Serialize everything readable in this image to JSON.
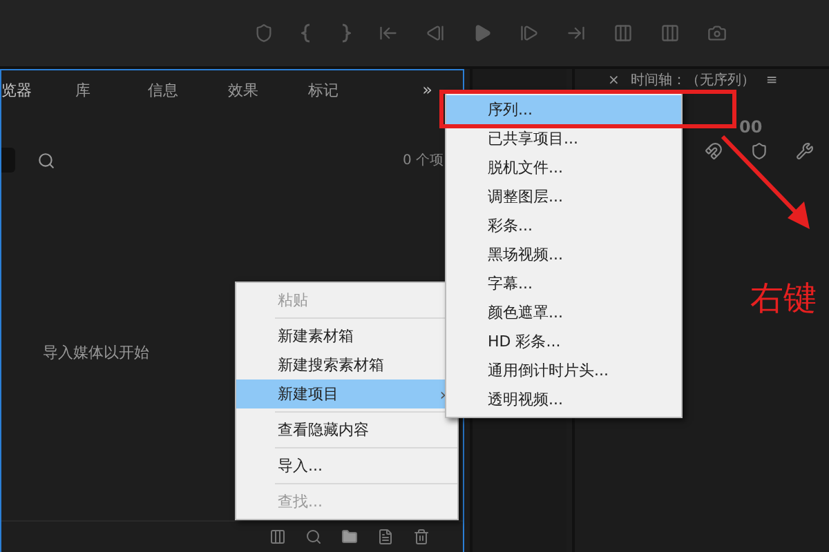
{
  "project_panel": {
    "tabs": [
      {
        "label": "览器",
        "selected": true
      },
      {
        "label": "库",
        "selected": false
      },
      {
        "label": "信息",
        "selected": false
      },
      {
        "label": "效果",
        "selected": false
      },
      {
        "label": "标记",
        "selected": false
      }
    ],
    "overflow": "»",
    "item_count": "0 个项",
    "empty_hint": "导入媒体以开始"
  },
  "timeline_panel": {
    "close": "×",
    "title": "时间轴：（无序列）",
    "menu": "≡",
    "timecode": "00"
  },
  "context_menu": {
    "groups": [
      [
        {
          "label": "粘贴",
          "disabled": true,
          "selected": false
        }
      ],
      [
        {
          "label": "新建素材箱",
          "disabled": false,
          "selected": false
        },
        {
          "label": "新建搜索素材箱",
          "disabled": false,
          "selected": false
        },
        {
          "label": "新建项目",
          "disabled": false,
          "selected": true,
          "submenu": "›"
        }
      ],
      [
        {
          "label": "查看隐藏内容",
          "disabled": false,
          "selected": false
        }
      ],
      [
        {
          "label": "导入...",
          "disabled": false,
          "selected": false
        }
      ],
      [
        {
          "label": "查找...",
          "disabled": true,
          "selected": false
        }
      ]
    ]
  },
  "submenu": {
    "items": [
      {
        "label": "序列...",
        "selected": true
      },
      {
        "label": "已共享项目...",
        "selected": false
      },
      {
        "label": "脱机文件...",
        "selected": false
      },
      {
        "label": "调整图层...",
        "selected": false
      },
      {
        "label": "彩条...",
        "selected": false
      },
      {
        "label": "黑场视频...",
        "selected": false
      },
      {
        "label": "字幕...",
        "selected": false
      },
      {
        "label": "颜色遮罩...",
        "selected": false
      },
      {
        "label": "HD 彩条...",
        "selected": false
      },
      {
        "label": "通用倒计时片头...",
        "selected": false
      },
      {
        "label": "透明视频...",
        "selected": false
      }
    ]
  },
  "annotation": {
    "text": "右键"
  }
}
